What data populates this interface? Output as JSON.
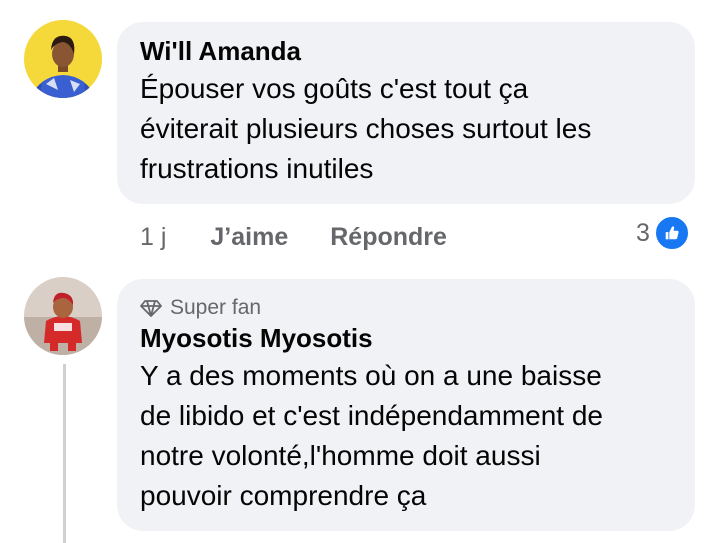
{
  "comments": [
    {
      "author": "Wi'll Amanda",
      "avatar_icon": "profile-photo-woman-yellow-background",
      "text_lines": [
        "Épouser vos goûts c'est tout ça",
        "éviterait plusieurs choses surtout les",
        "frustrations inutiles"
      ],
      "timestamp": "1 j",
      "like_label": "J’aime",
      "reply_label": "Répondre",
      "reaction_count": "3",
      "reaction_icon": "like-thumbs-up-icon"
    },
    {
      "badge_icon": "diamond-icon",
      "badge": "Super fan",
      "author": "Myosotis Myosotis",
      "avatar_icon": "profile-photo-child-red-outfit",
      "text_lines": [
        "Y a des moments où on a une baisse",
        "de libido et c'est indépendamment de",
        "notre volonté,l'homme doit aussi",
        "pouvoir comprendre ça"
      ]
    }
  ],
  "colors": {
    "bubble_bg": "#f0f2f5",
    "secondary_text": "#65676b",
    "like_blue": "#1877f2",
    "avatar1_bg": "#f5d83a",
    "thread_line": "#ced0d4"
  }
}
